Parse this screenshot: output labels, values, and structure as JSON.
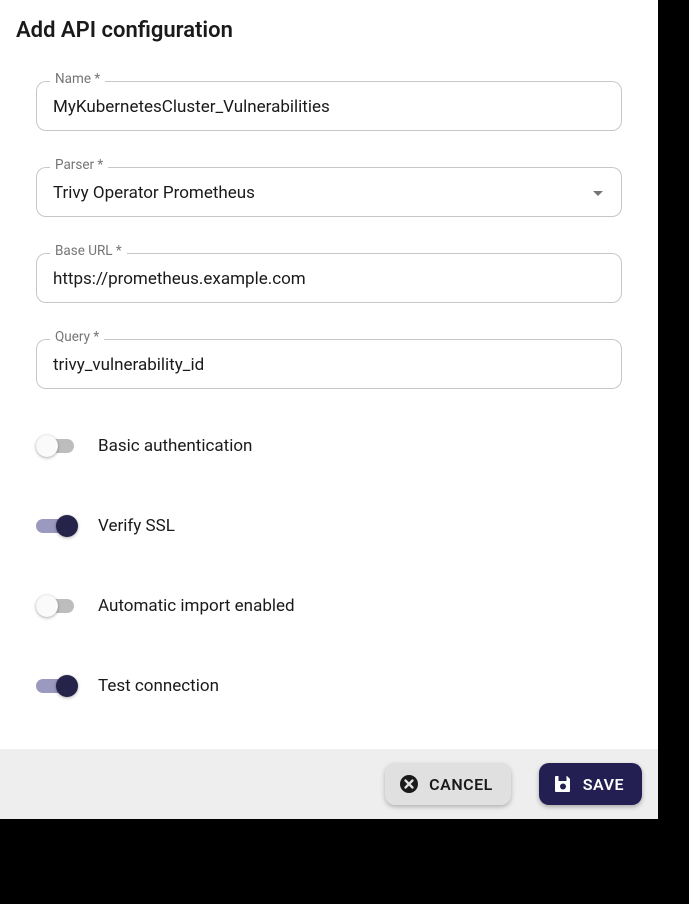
{
  "title": "Add API configuration",
  "fields": {
    "name": {
      "label": "Name *",
      "value": "MyKubernetesCluster_Vulnerabilities"
    },
    "parser": {
      "label": "Parser *",
      "value": "Trivy Operator Prometheus"
    },
    "base_url": {
      "label": "Base URL *",
      "value": "https://prometheus.example.com"
    },
    "query": {
      "label": "Query *",
      "value": "trivy_vulnerability_id"
    }
  },
  "toggles": {
    "basic_auth": {
      "label": "Basic authentication",
      "on": false
    },
    "verify_ssl": {
      "label": "Verify SSL",
      "on": true
    },
    "auto_import": {
      "label": "Automatic import enabled",
      "on": false
    },
    "test_connection": {
      "label": "Test connection",
      "on": true
    }
  },
  "actions": {
    "cancel": "CANCEL",
    "save": "SAVE"
  }
}
